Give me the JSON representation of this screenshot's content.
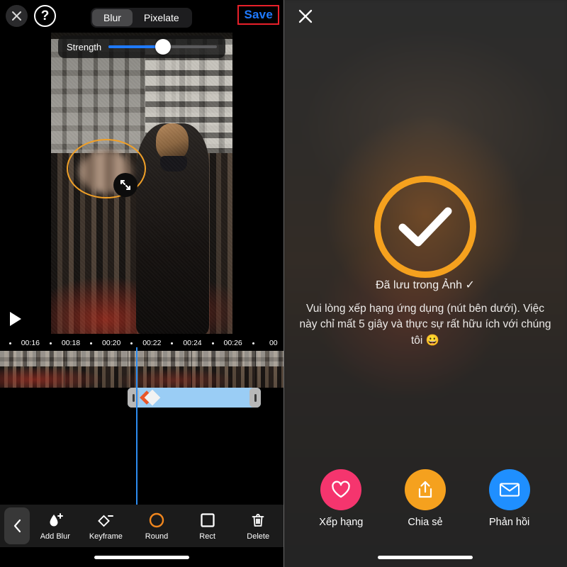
{
  "editor": {
    "close_icon": "close-x-icon",
    "help_icon": "question-mark-icon",
    "help_label": "?",
    "modes": [
      {
        "label": "Blur",
        "active": true
      },
      {
        "label": "Pixelate",
        "active": false
      }
    ],
    "save_label": "Save",
    "save_color": "#1f7aff",
    "annotation_box_color": "#e8202a",
    "strength": {
      "label": "Strength",
      "value_percent": 50,
      "fill_color": "#1f7aff"
    },
    "shape_overlay": {
      "type": "ellipse",
      "stroke_color": "#f0a028",
      "handle_icon": "resize-diagonal-icon"
    },
    "play_icon": "play-triangle-icon",
    "timeline": {
      "ticks": [
        "•",
        "00:16",
        "•",
        "00:18",
        "•",
        "00:20",
        "•",
        "00:22",
        "•",
        "00:24",
        "•",
        "00:26",
        "•",
        "00"
      ],
      "playhead_color": "#2d8cf0",
      "clip_color": "#9acdf5",
      "keyframe_colors": [
        "#e8562a",
        "#f2f2f2"
      ]
    },
    "toolbar": {
      "back_icon": "chevron-left-icon",
      "items": [
        {
          "label": "Add Blur",
          "icon": "droplet-plus-icon",
          "active": false
        },
        {
          "label": "Keyframe",
          "icon": "diamond-minus-icon",
          "active": false
        },
        {
          "label": "Round",
          "icon": "circle-outline-icon",
          "active": true
        },
        {
          "label": "Rect",
          "icon": "square-outline-icon",
          "active": false
        },
        {
          "label": "Delete",
          "icon": "trash-icon",
          "active": false
        }
      ],
      "active_color": "#f0861e"
    }
  },
  "save_screen": {
    "close_icon": "close-x-icon",
    "check_icon": "checkmark-icon",
    "check_ring_color": "#f5a11e",
    "saved_text": "Đã lưu trong Ảnh ✓",
    "rate_message": "Vui lòng xếp hạng ứng dụng (nút bên dưới). Việc này chỉ mất 5 giây và thực sự rất hữu ích với chúng tôi 😀",
    "actions": [
      {
        "label": "Xếp hạng",
        "icon": "heart-icon",
        "color": "#f5356e"
      },
      {
        "label": "Chia sẻ",
        "icon": "share-up-icon",
        "color": "#f5a11e"
      },
      {
        "label": "Phản hồi",
        "icon": "envelope-icon",
        "color": "#1f8fff"
      }
    ]
  }
}
